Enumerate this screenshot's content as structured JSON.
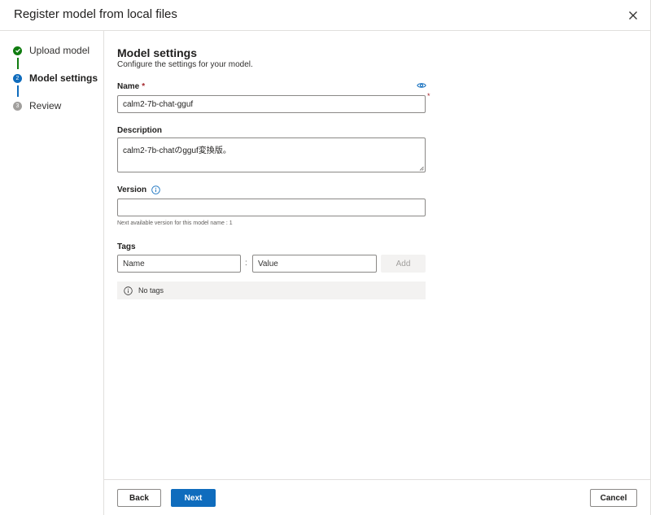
{
  "dialog": {
    "title": "Register model from local files"
  },
  "steps": [
    {
      "label": "Upload model",
      "state": "complete",
      "number": "1"
    },
    {
      "label": "Model settings",
      "state": "active",
      "number": "2"
    },
    {
      "label": "Review",
      "state": "pending",
      "number": "3"
    }
  ],
  "form": {
    "section_title": "Model settings",
    "section_subtitle": "Configure the settings for your model.",
    "name_label": "Name",
    "name_required": "*",
    "name_value": "calm2-7b-chat-gguf",
    "description_label": "Description",
    "description_value": "calm2-7b-chatのgguf変換版。",
    "version_label": "Version",
    "version_value": "",
    "version_hint": "Next available version for this model name : 1",
    "tags_label": "Tags",
    "tag_name_placeholder": "Name",
    "tag_separator": ":",
    "tag_value_placeholder": "Value",
    "add_label": "Add",
    "no_tags_text": "No tags"
  },
  "footer": {
    "back_label": "Back",
    "next_label": "Next",
    "cancel_label": "Cancel"
  },
  "colors": {
    "accent": "#0f6cbd",
    "complete": "#107c10",
    "pending": "#8a8886",
    "required": "#a4262c"
  },
  "icons": {
    "close": "close-icon",
    "check": "checkmark-icon",
    "info": "info-icon",
    "eye": "eye-icon"
  }
}
